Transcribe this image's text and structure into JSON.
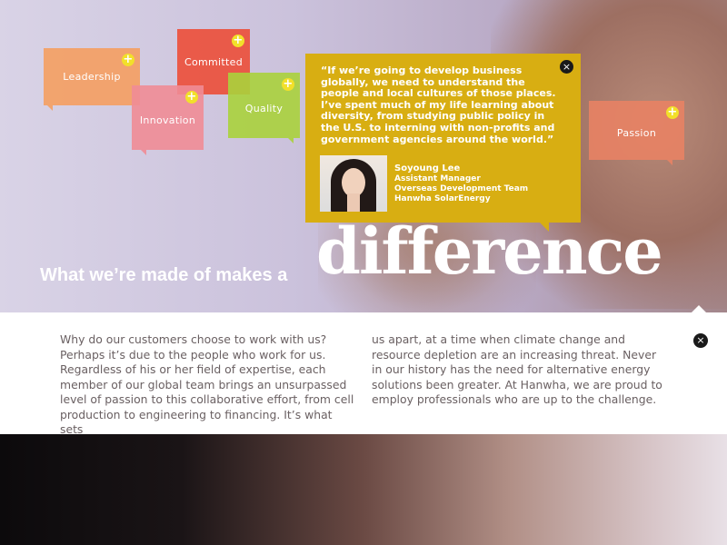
{
  "tags": {
    "leadership": "Leadership",
    "committed": "Committed",
    "innovation": "Innovation",
    "quality": "Quality",
    "passion": "Passion",
    "plus_glyph": "+"
  },
  "quote": {
    "text": "“If we’re going to develop business globally, we need to understand the people and local cultures of those places. I’ve spent much of my life learning about diversity, from studying public policy in the U.S. to interning with non-profits and government agencies around the world.”",
    "close_glyph": "×",
    "person": {
      "name": "Soyoung Lee",
      "title": "Assistant Manager",
      "team": "Overseas Development Team",
      "company": "Hanwha SolarEnergy"
    }
  },
  "headline": {
    "lead": "What we’re made of makes a",
    "big": "difference"
  },
  "panel": {
    "col1": "Why do our customers choose to work with us? Perhaps it’s due to the people who work for us. Regardless of his or her field of expertise, each member of our global team brings an unsurpassed level of passion to this collaborative effort, from cell production to engineering to financing. It’s what sets",
    "col2": "us apart, at a time when climate change and resource depletion are an increasing threat. Never in our history has the need for alternative energy solutions been greater. At Hanwha, we are proud to employ professionals who are up to the challenge.",
    "close_glyph": "×"
  },
  "colors": {
    "quote_bg": "#d8ae12",
    "leadership": "#f4a064",
    "committed": "#ec503c",
    "innovation": "#f08c96",
    "quality": "#aad23c",
    "passion": "#e88264",
    "plus_badge": "#f2e02a"
  },
  "icons": {
    "tag_expand": "plus-icon",
    "close": "close-icon"
  }
}
